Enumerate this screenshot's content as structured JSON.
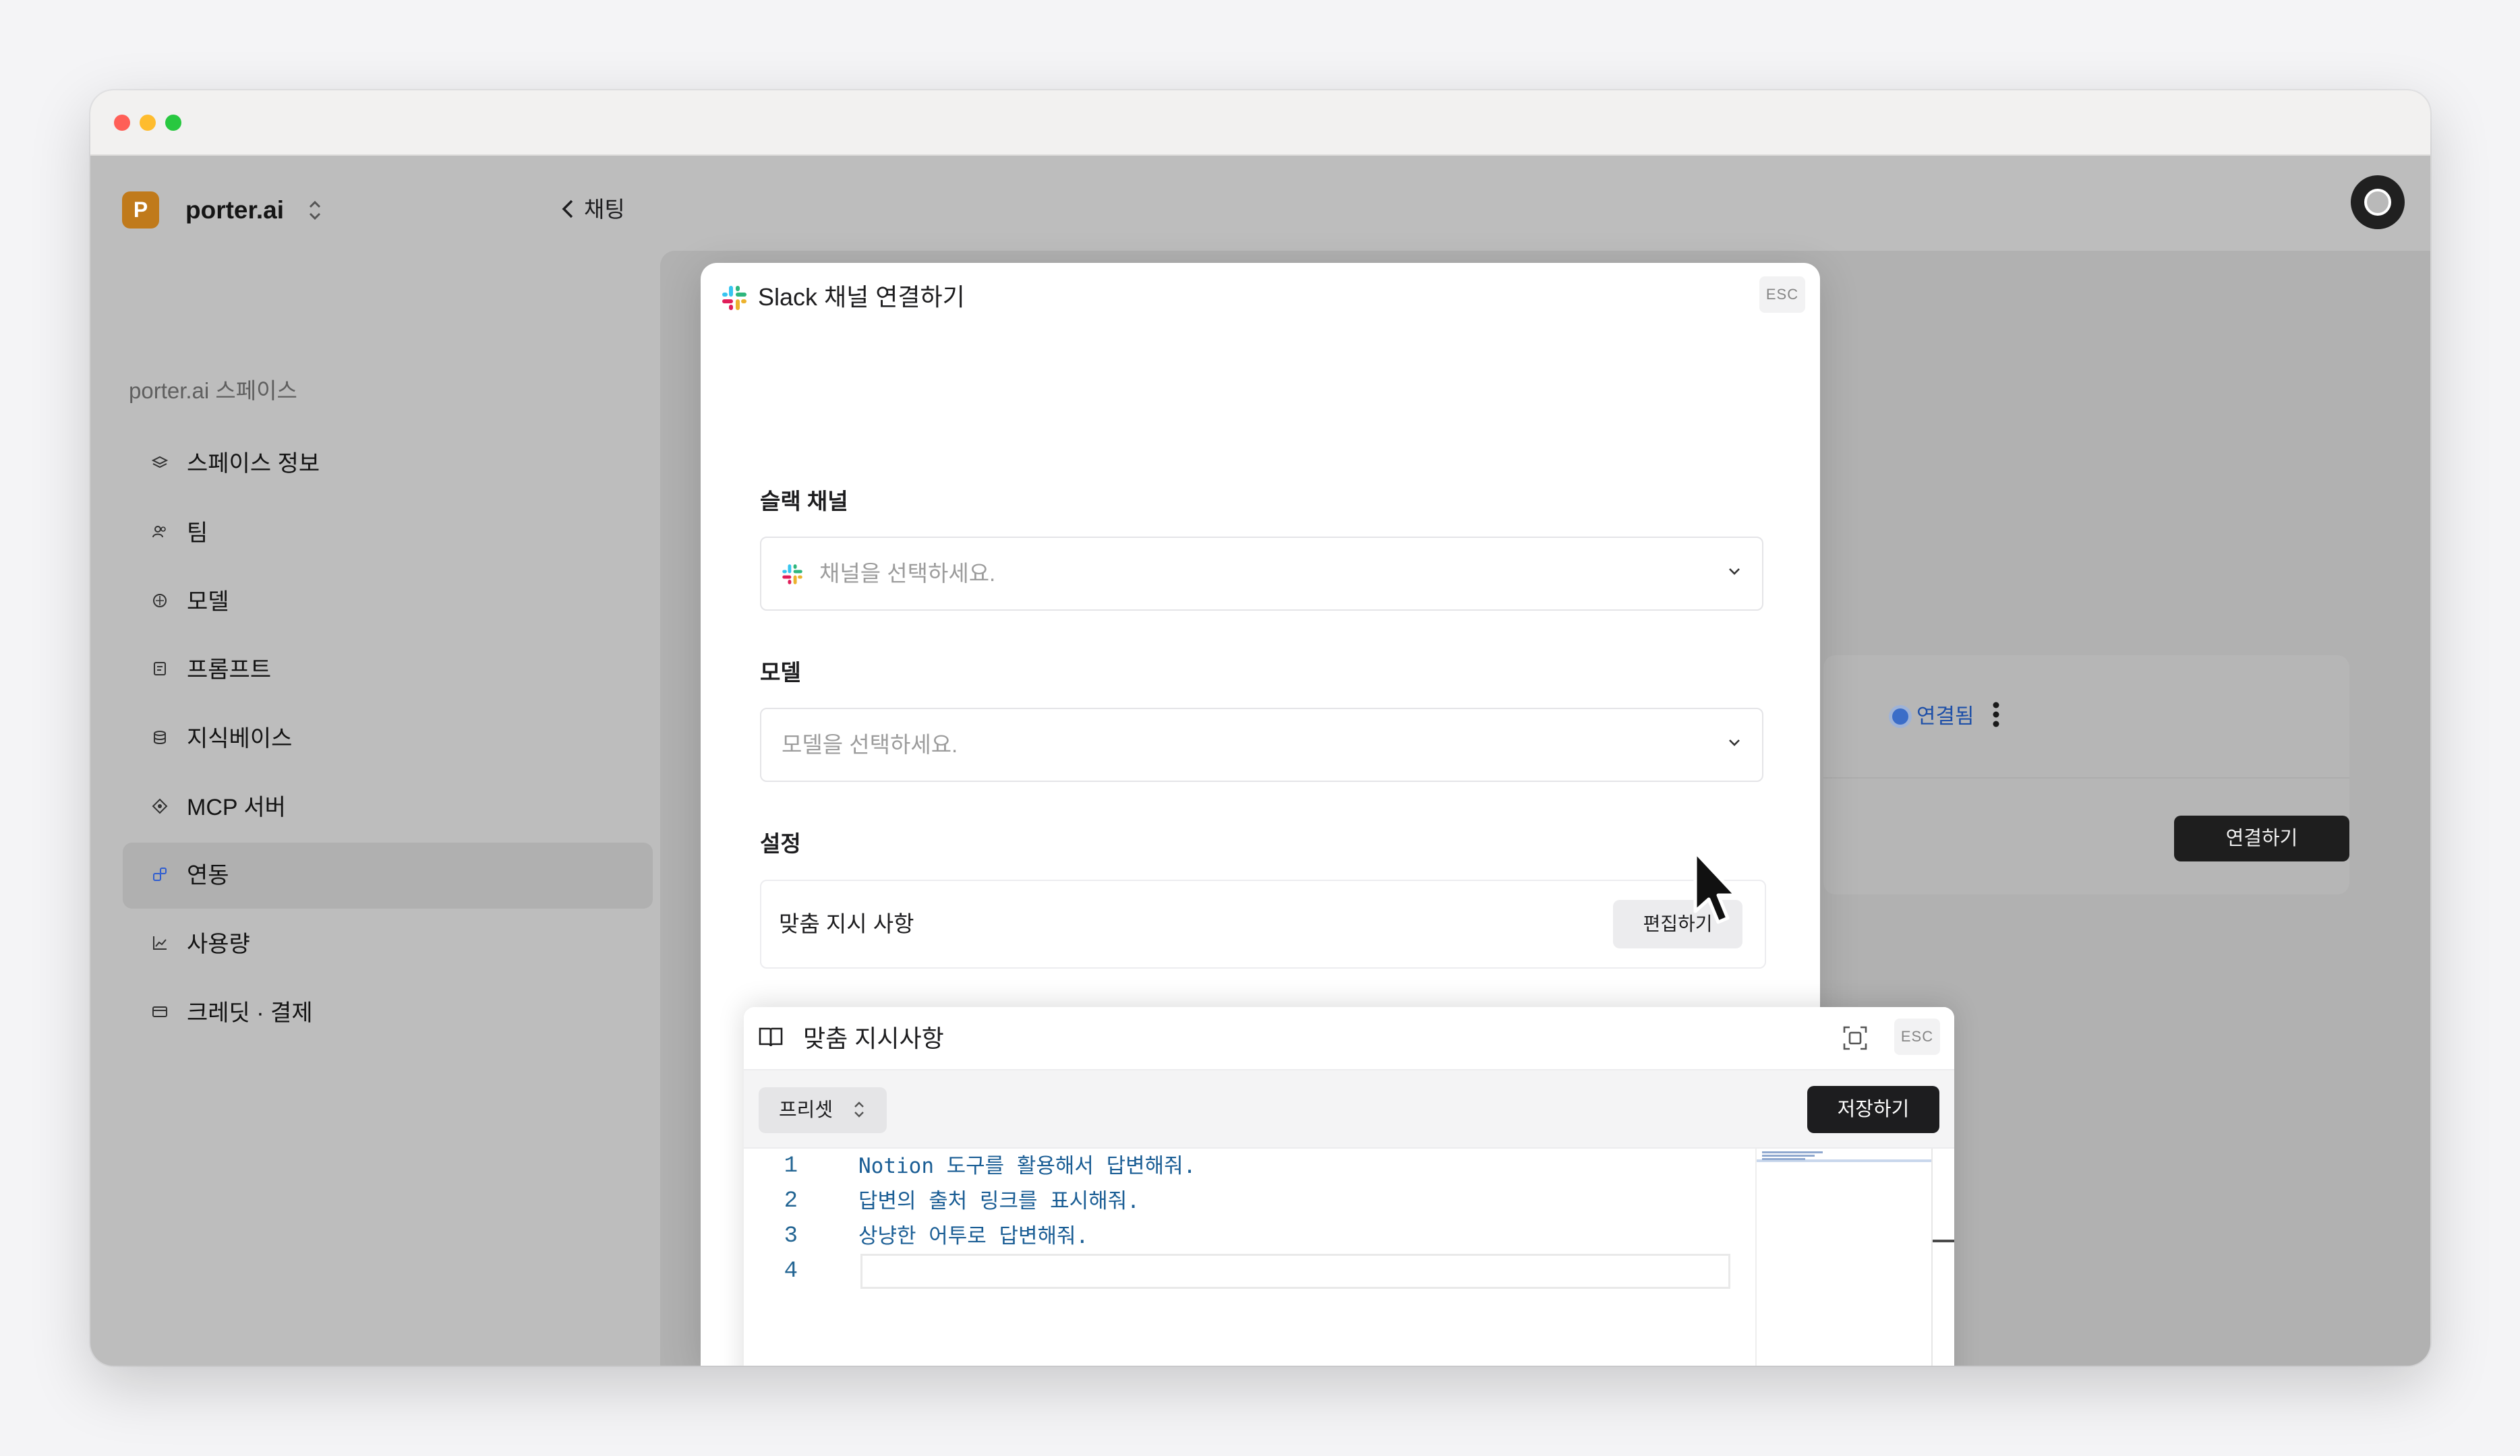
{
  "workspace": {
    "logo_letter": "P",
    "name": "porter.ai"
  },
  "header": {
    "back_label": "채팅"
  },
  "sidebar": {
    "section_title": "porter.ai 스페이스",
    "items": [
      {
        "label": "스페이스 정보",
        "icon": "layers-icon"
      },
      {
        "label": "팀",
        "icon": "users-icon"
      },
      {
        "label": "모델",
        "icon": "model-icon"
      },
      {
        "label": "프롬프트",
        "icon": "prompt-icon"
      },
      {
        "label": "지식베이스",
        "icon": "database-icon"
      },
      {
        "label": "MCP 서버",
        "icon": "mcp-icon"
      },
      {
        "label": "연동",
        "icon": "integration-icon",
        "active": true
      },
      {
        "label": "사용량",
        "icon": "chart-icon"
      },
      {
        "label": "크레딧 · 결제",
        "icon": "card-icon"
      }
    ]
  },
  "integration_card": {
    "status": "연결됨",
    "connect_label": "연결하기"
  },
  "slack_modal": {
    "title": "Slack 채널 연결하기",
    "esc": "ESC",
    "channel_label": "슬랙 채널",
    "channel_placeholder": "채널을 선택하세요.",
    "model_label": "모델",
    "model_placeholder": "모델을 선택하세요.",
    "settings_label": "설정",
    "custom_instructions_label": "맞춤 지시 사항",
    "edit_label": "편집하기"
  },
  "instructions_panel": {
    "title": "맞춤 지시사항",
    "esc": "ESC",
    "preset_label": "프리셋",
    "save_label": "저장하기",
    "lines": [
      {
        "no": "1",
        "text": "Notion 도구를 활용해서 답변해줘."
      },
      {
        "no": "2",
        "text": "답변의 출처 링크를 표시해줘."
      },
      {
        "no": "3",
        "text": "상냥한 어투로 답변해줘."
      },
      {
        "no": "4",
        "text": ""
      }
    ]
  },
  "colors": {
    "accent": "#3b6dc8",
    "brand_logo": "#c07a1b",
    "dark_button": "#1d1d1f"
  }
}
